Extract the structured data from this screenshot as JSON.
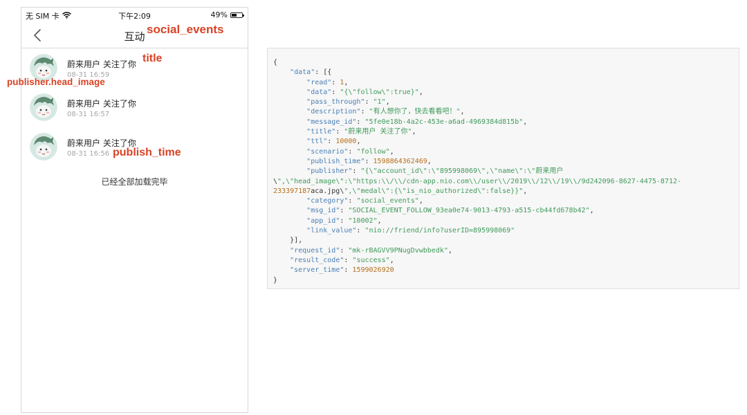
{
  "status_bar": {
    "carrier": "无 SIM 卡",
    "time": "下午2:09",
    "battery_percent": "49%",
    "battery_level": 0.49
  },
  "nav": {
    "title": "互动",
    "back_icon": "chevron-left-icon"
  },
  "list": {
    "items": [
      {
        "title": "蔚来用户 关注了你",
        "time": "08-31 16:59"
      },
      {
        "title": "蔚来用户 关注了你",
        "time": "08-31 16:57"
      },
      {
        "title": "蔚来用户 关注了你",
        "time": "08-31 16:56"
      }
    ],
    "end_text": "已经全部加载完毕"
  },
  "annotations": {
    "category": "social_events",
    "title": "title",
    "head_image": "publisher.head_image",
    "publish_time": "publish_time",
    "color": "#d94225"
  },
  "json_panel": {
    "lines": [
      "{",
      "    \"data\": [{",
      "        \"read\": 1,",
      "        \"data\": \"{\\\"follow\\\":true}\",",
      "        \"pass_through\": \"1\",",
      "        \"description\": \"有人想你了，快去看看吧！\",",
      "        \"message_id\": \"5fe0e18b-4a2c-453e-a6ad-4969384d815b\",",
      "        \"title\": \"蔚来用户 关注了你\",",
      "        \"ttl\": 10000,",
      "        \"scenario\": \"follow\",",
      "        \"publish_time\": 1598864362469,",
      "        \"publisher\": \"{\\\"account_id\\\":\\\"895998069\\\",\\\"name\\\":\\\"蔚来用户",
      "\\\",\\\"head_image\\\":\\\"https:\\\\/\\\\/cdn-app.nio.com\\\\/user\\\\/2019\\\\/12\\\\/19\\\\/9d242096-8627-4475-8712-",
      "233397187aca.jpg\\\",\\\"medal\\\":{\\\"is_nio_authorized\\\":false}}\",",
      "        \"category\": \"social_events\",",
      "        \"msg_id\": \"SOCIAL_EVENT_FOLLOW_93ea0e74-9013-4793-a515-cb44fd678b42\",",
      "        \"app_id\": \"10002\",",
      "        \"link_value\": \"nio://friend/info?userID=895998069\"",
      "    }],",
      "    \"request_id\": \"mk-rBAGVV9PNugDvwbbedk\",",
      "    \"result_code\": \"success\",",
      "    \"server_time\": 1599026920",
      "}"
    ]
  },
  "colors": {
    "json_key": "#4a7fb5",
    "json_string": "#3f9a5a",
    "json_number": "#b66e1a",
    "panel_bg": "#f7f7f7"
  }
}
